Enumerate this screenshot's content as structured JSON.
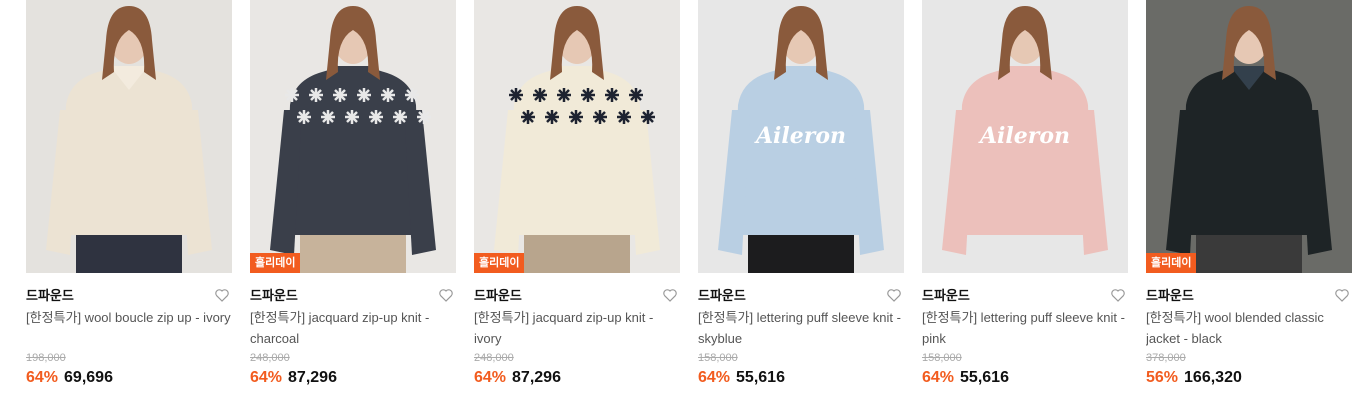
{
  "colors": {
    "accent": "#f25c1f",
    "original_price": "#aaaaaa",
    "name_text": "#555555"
  },
  "products": [
    {
      "badge": "",
      "brand": "드파운드",
      "name": "[한정특가] wool boucle zip up - ivory",
      "original_price": "198,000",
      "discount": "64%",
      "price": "69,696",
      "icon": "heart-icon"
    },
    {
      "badge": "홀리데이",
      "brand": "드파운드",
      "name": "[한정특가] jacquard zip-up knit - charcoal",
      "original_price": "248,000",
      "discount": "64%",
      "price": "87,296",
      "icon": "heart-icon"
    },
    {
      "badge": "홀리데이",
      "brand": "드파운드",
      "name": "[한정특가] jacquard zip-up knit - ivory",
      "original_price": "248,000",
      "discount": "64%",
      "price": "87,296",
      "icon": "heart-icon"
    },
    {
      "badge": "",
      "brand": "드파운드",
      "name": "[한정특가] lettering puff sleeve knit - skyblue",
      "original_price": "158,000",
      "discount": "64%",
      "price": "55,616",
      "icon": "heart-icon"
    },
    {
      "badge": "",
      "brand": "드파운드",
      "name": "[한정특가] lettering puff sleeve knit - pink",
      "original_price": "158,000",
      "discount": "64%",
      "price": "55,616",
      "icon": "heart-icon"
    },
    {
      "badge": "홀리데이",
      "brand": "드파운드",
      "name": "[한정특가] wool blended classic jacket - black",
      "original_price": "378,000",
      "discount": "56%",
      "price": "166,320",
      "icon": "heart-icon"
    }
  ],
  "images": [
    {
      "bg": "#e4e2de",
      "top": "#ece3d3",
      "inner": "#f3ebde",
      "bottom": "#2f3340",
      "pattern": "",
      "lettering": ""
    },
    {
      "bg": "#e9e7e4",
      "top": "#3a3f4a",
      "inner": "#3a3f4a",
      "bottom": "#c7b39b",
      "pattern": "#e8e8e8",
      "lettering": ""
    },
    {
      "bg": "#e9e7e4",
      "top": "#f1ead8",
      "inner": "#f1ead8",
      "bottom": "#b8a58d",
      "pattern": "#1e2330",
      "lettering": ""
    },
    {
      "bg": "#e7e7e7",
      "top": "#b9cfe3",
      "inner": "#b9cfe3",
      "bottom": "#1c1c1e",
      "pattern": "",
      "lettering": "Aileron"
    },
    {
      "bg": "#e7e7e7",
      "top": "#ecc0bb",
      "inner": "#ecc0bb",
      "bottom": "#e7e7e7",
      "pattern": "",
      "lettering": "Aileron"
    },
    {
      "bg": "#6a6b67",
      "top": "#1e2426",
      "inner": "#33404c",
      "bottom": "#3a3a3a",
      "pattern": "",
      "lettering": ""
    }
  ]
}
